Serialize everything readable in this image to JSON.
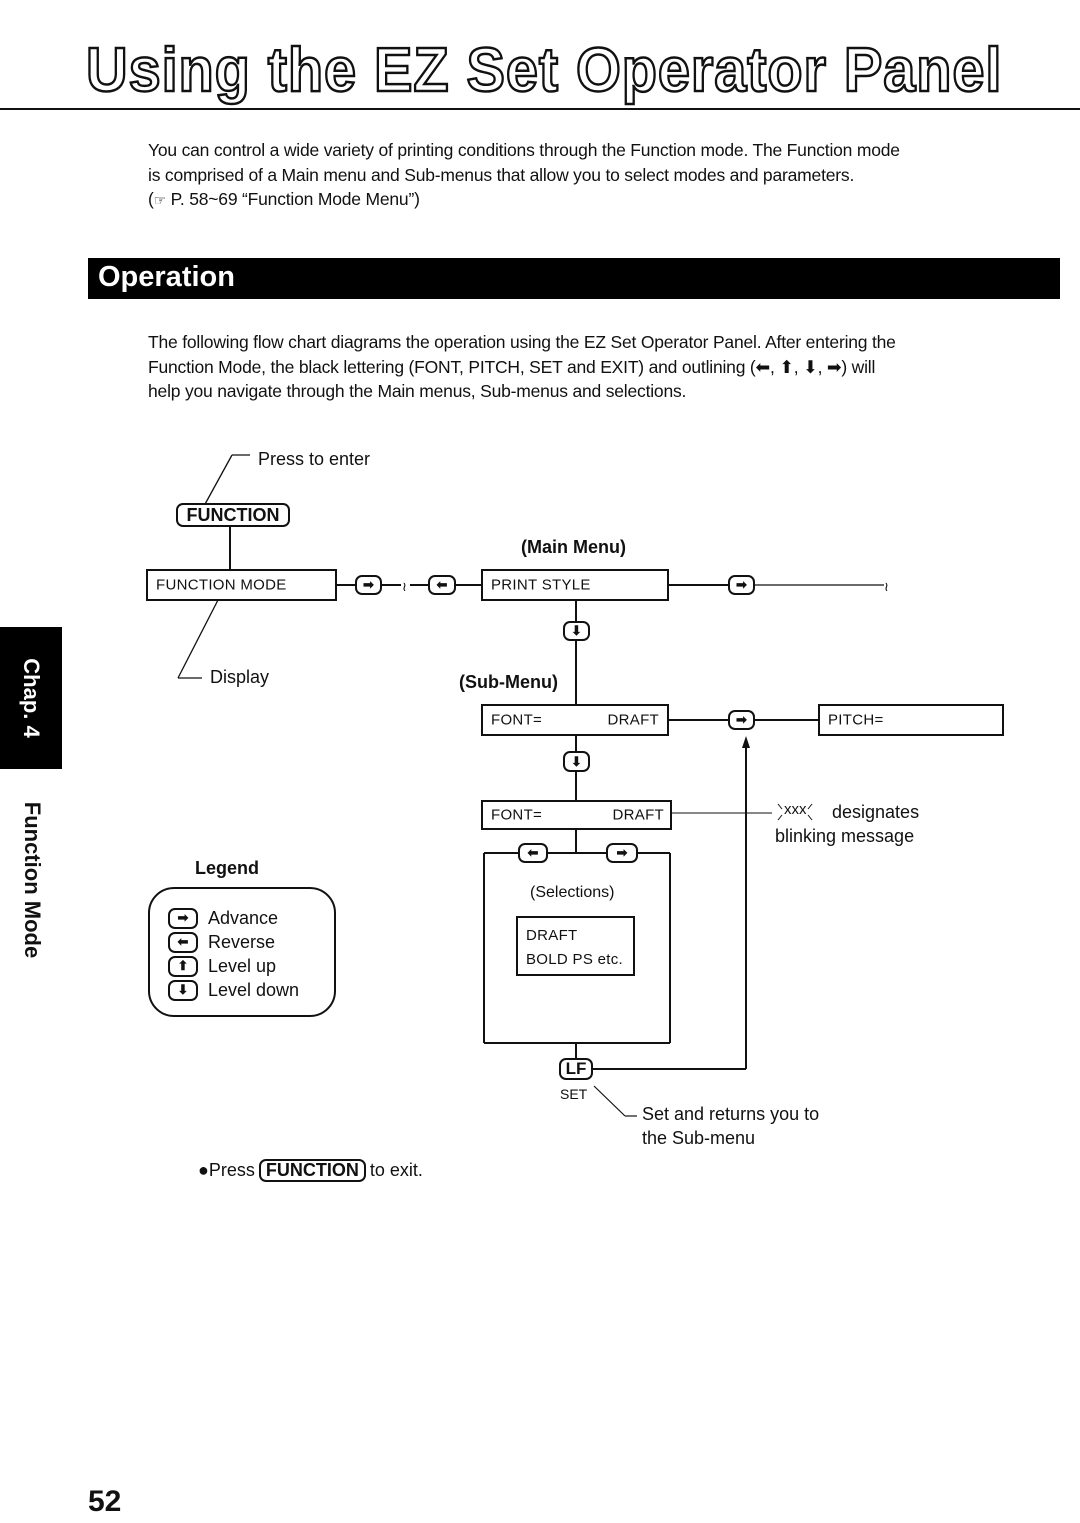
{
  "page": {
    "title": "Using the EZ Set Operator Panel",
    "page_number": "52",
    "side_tab": {
      "chapter": "Chap. 4",
      "section": "Function Mode"
    }
  },
  "intro": {
    "line1": "You can control a wide variety of printing conditions through the Function mode. The Function mode",
    "line2": "is comprised of a Main menu and Sub-menus that allow you to select modes and parameters.",
    "reference_icon": "pointing-hand-icon",
    "reference": "P. 58~69 “Function Mode Menu”)",
    "reference_open": "("
  },
  "section": {
    "heading": "Operation",
    "line1": "The following flow chart diagrams the operation using the EZ Set Operator Panel. After entering the",
    "line2": "Function Mode, the black lettering (FONT, PITCH, SET and EXIT) and outlining (⬅, ⬆, ⬇, ➡) will",
    "line3": "help you navigate through the Main menus, Sub-menus and selections."
  },
  "flowchart": {
    "press_to_enter": "Press to enter",
    "function_key": "FUNCTION",
    "display_label": "Display",
    "main_menu_label": "(Main Menu)",
    "sub_menu_label": "(Sub-Menu)",
    "lcd_function_mode": "FUNCTION  MODE",
    "lcd_print_style": "PRINT  STYLE",
    "lcd_font_left": "FONT=",
    "lcd_font_right": "DRAFT",
    "lcd_pitch": "PITCH=",
    "lcd_font_blink_left": "FONT=",
    "lcd_font_blink_right": "DRAFT",
    "selections_label": "(Selections)",
    "selection_line1": "DRAFT",
    "selection_line2": "BOLD PS etc.",
    "blink_note_marker": "xxx",
    "blink_note_line1": "designates",
    "blink_note_line2": "blinking message",
    "lf_key": "LF",
    "set_label": "SET",
    "set_note_line1": "Set and returns you to",
    "set_note_line2": "the Sub-menu",
    "exit_prefix": "●Press",
    "exit_key": "FUNCTION",
    "exit_suffix": "to exit.",
    "arrow_right": "➡",
    "arrow_left": "⬅",
    "arrow_up": "⬆",
    "arrow_down": "⬇"
  },
  "legend": {
    "title": "Legend",
    "items": [
      {
        "icon": "arrow-right-key-icon",
        "glyph": "➡",
        "label": "Advance"
      },
      {
        "icon": "arrow-left-key-icon",
        "glyph": "⬅",
        "label": "Reverse"
      },
      {
        "icon": "arrow-up-key-icon",
        "glyph": "⬆",
        "label": "Level up"
      },
      {
        "icon": "arrow-down-key-icon",
        "glyph": "⬇",
        "label": "Level down"
      }
    ]
  }
}
